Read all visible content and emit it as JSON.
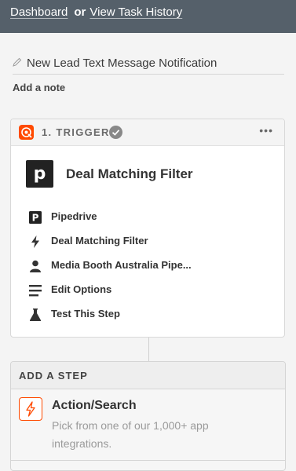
{
  "topbar": {
    "dashboard_link": "Dashboard",
    "or_text": "or",
    "history_link": "View Task History"
  },
  "zap": {
    "name": "New Lead Text Message Notification",
    "add_note": "Add a note"
  },
  "trigger": {
    "label": "1. TRIGGER",
    "more": "•••",
    "title": "Deal Matching Filter",
    "app_logo_letter": "p",
    "items": [
      {
        "label": "Pipedrive",
        "icon": "pipedrive-logo-icon"
      },
      {
        "label": "Deal Matching Filter",
        "icon": "bolt-icon"
      },
      {
        "label": "Media Booth Australia Pipe...",
        "icon": "person-icon"
      },
      {
        "label": "Edit Options",
        "icon": "lines-icon"
      },
      {
        "label": "Test This Step",
        "icon": "flask-icon"
      }
    ]
  },
  "add_step": {
    "header": "ADD A STEP",
    "action_title": "Action/Search",
    "action_desc": "Pick from one of our 1,000+ app integrations."
  },
  "colors": {
    "topbar": "#55606a",
    "accent": "#ff4a00",
    "check": "#888888"
  }
}
